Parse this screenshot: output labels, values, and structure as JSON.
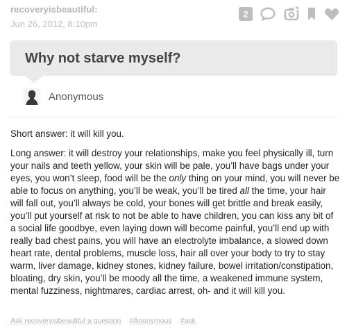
{
  "post": {
    "username": "recoveryisbeautiful:",
    "timestamp": "Jun 26, 2012, 8:10pm",
    "notes_count": "2",
    "icons": [
      "notes-badge",
      "reply-icon",
      "reblog-icon",
      "bookmark-icon",
      "like-icon"
    ]
  },
  "question": {
    "text": "Why not starve myself?",
    "asker": "Anonymous"
  },
  "answer": {
    "short": "Short answer: it will kill you.",
    "long_p1": "Long answer: it will destroy your relationships, make you feel physically ill, turn your nails and teeth yellow, your skin will be pale, you’ll have bags under your eyes, you won’t sleep, food will be the ",
    "long_em1": "only",
    "long_p2": " thing on your mind, you will never be able to focus on anything, you’ll be weak, you’ll be tired ",
    "long_em2": "all",
    "long_p3": " the time, your hair will fall out, you’ll always be cold, your bones will get brittle and break easily, you’ll put yourself at risk to not be able to have children, you can kiss any bit of a social life goodbye, even laying down will become painful, you’ll end up with really bad chest pains, you will have an electrolyte imbalance, a slowed down heart rate, dental problems, muscle loss, hair all over your body to try to stay warm, liver damage, kidney stones, kidney failure, bowel irritation/constipation, bloating, dry skin, you’ll be moody all the time, a weakened immune system, mental fuzziness, nightmares, cardiac arrest, oh- and it will kill you."
  },
  "footer": {
    "ask_link": "Ask recoveryisbeautiful a question",
    "tags": [
      "#Anonymous",
      "#ask"
    ]
  }
}
